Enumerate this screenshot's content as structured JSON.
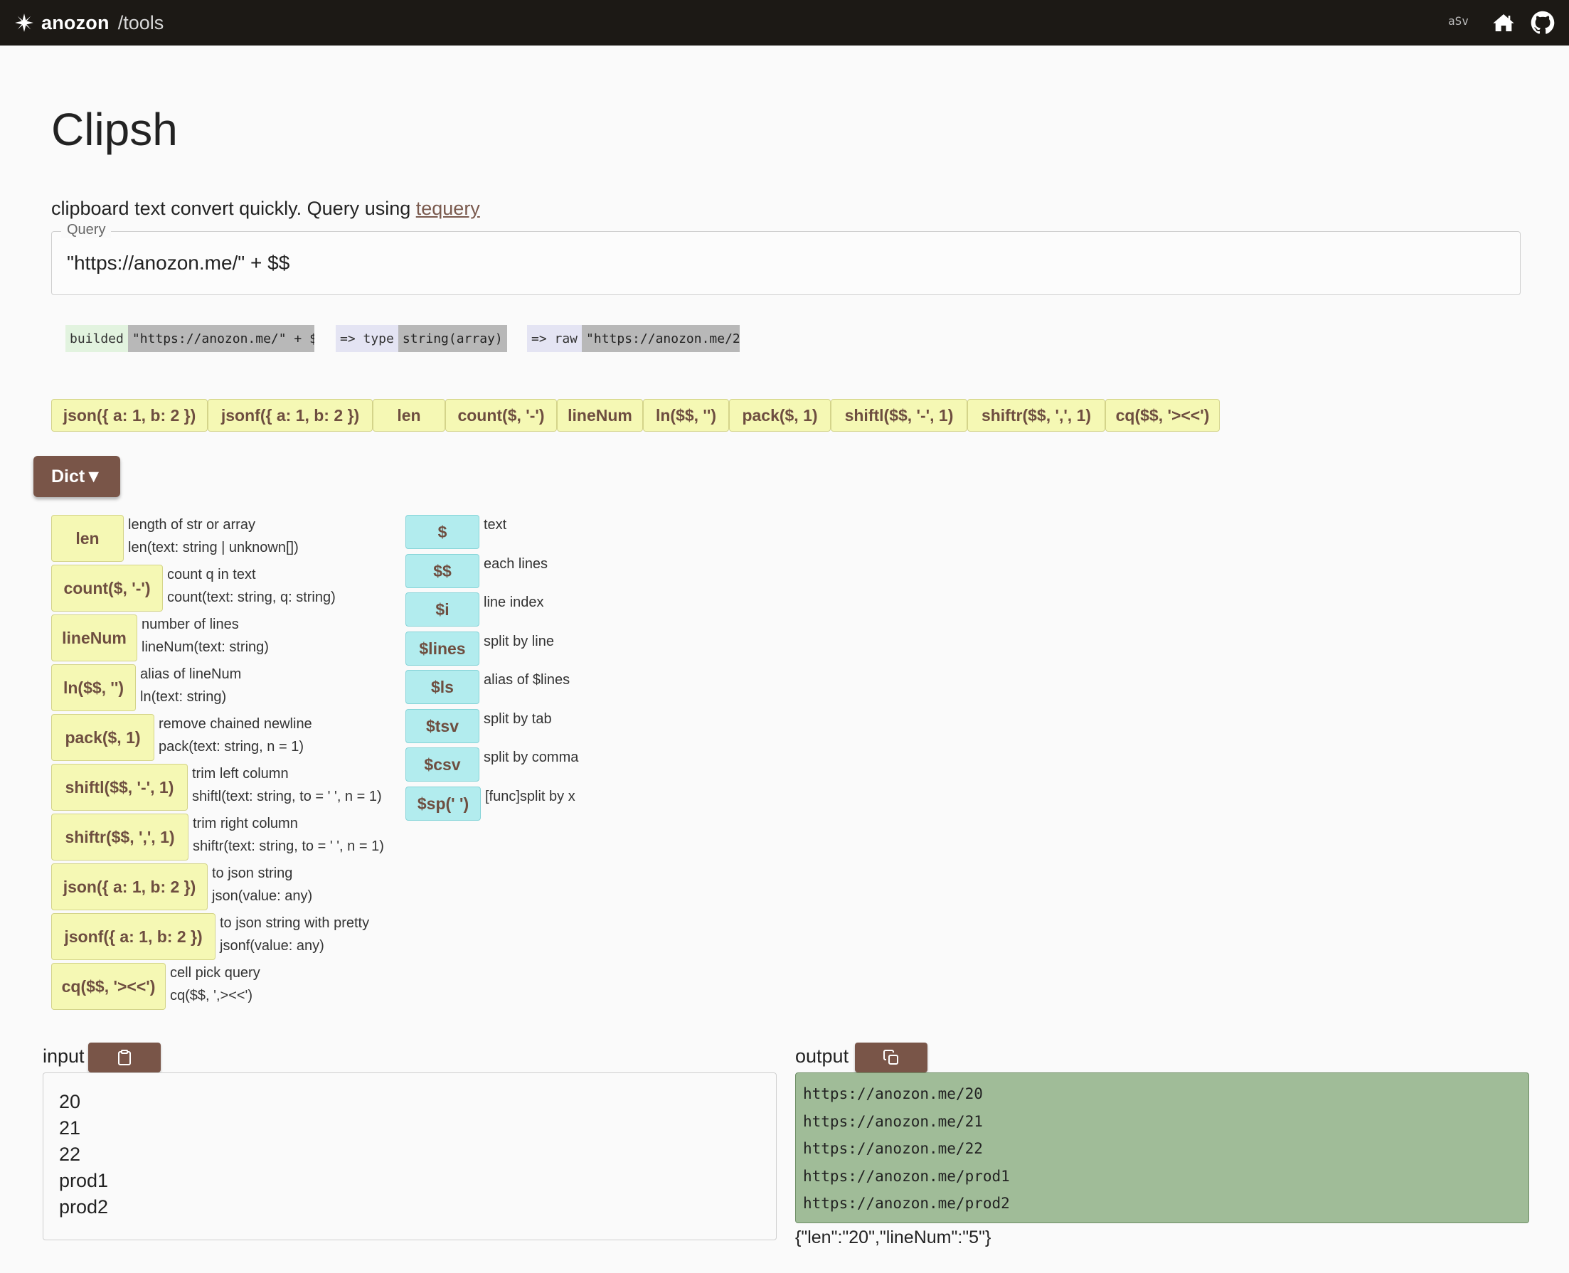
{
  "header": {
    "brand_name": "anozon",
    "brand_path": "/tools",
    "asv_label": "aSv",
    "home_icon": "home-icon",
    "github_icon": "github-icon"
  },
  "page": {
    "title": "Clipsh",
    "intro_text": "clipboard text convert quickly. Query using ",
    "intro_link": "tequery"
  },
  "query": {
    "legend": "Query",
    "value": "\"https://anozon.me/\" + $$"
  },
  "status": {
    "builded_label": "builded",
    "builded_value": "\"https://anozon.me/\" + $",
    "type_label": "=> type",
    "type_value": "string(array)",
    "raw_label": "=> raw",
    "raw_value": "\"https://anozon.me/2"
  },
  "quick_buttons": [
    "json({ a: 1, b: 2 })",
    "jsonf({ a: 1, b: 2 })",
    "len",
    "count($, '-')",
    "lineNum",
    "ln($$, '')",
    "pack($, 1)",
    "shiftl($$, '-', 1)",
    "shiftr($$, ',', 1)",
    "cq($$, '><<')"
  ],
  "dict": {
    "toggle_label": "Dict▼",
    "functions": [
      {
        "tag": "len",
        "desc": "length of str or array",
        "sig": "len(text: string | unknown[])"
      },
      {
        "tag": "count($, '-')",
        "desc": "count q in text",
        "sig": "count(text: string, q: string)"
      },
      {
        "tag": "lineNum",
        "desc": "number of lines",
        "sig": "lineNum(text: string)"
      },
      {
        "tag": "ln($$, '')",
        "desc": "alias of lineNum",
        "sig": "ln(text: string)"
      },
      {
        "tag": "pack($, 1)",
        "desc": "remove chained newline",
        "sig": "pack(text: string, n = 1)"
      },
      {
        "tag": "shiftl($$, '-', 1)",
        "desc": "trim left column",
        "sig": "shiftl(text: string, to = ' ', n = 1)"
      },
      {
        "tag": "shiftr($$, ',', 1)",
        "desc": "trim right column",
        "sig": "shiftr(text: string, to = ' ', n = 1)"
      },
      {
        "tag": "json({ a: 1, b: 2 })",
        "desc": "to json string",
        "sig": "json(value: any)"
      },
      {
        "tag": "jsonf({ a: 1, b: 2 })",
        "desc": "to json string with pretty",
        "sig": "jsonf(value: any)"
      },
      {
        "tag": "cq($$, '><<')",
        "desc": "cell pick query",
        "sig": "cq($$, ',><<')"
      }
    ],
    "variables": [
      {
        "tag": "$",
        "desc": "text"
      },
      {
        "tag": "$$",
        "desc": "each lines"
      },
      {
        "tag": "$i",
        "desc": "line index"
      },
      {
        "tag": "$lines",
        "desc": "split by line"
      },
      {
        "tag": "$ls",
        "desc": "alias of $lines"
      },
      {
        "tag": "$tsv",
        "desc": "split by tab"
      },
      {
        "tag": "$csv",
        "desc": "split by comma"
      },
      {
        "tag": "$sp(' ')",
        "desc": "[func]split by x"
      }
    ]
  },
  "input": {
    "label": "input",
    "copy_icon": "paste-icon",
    "lines": [
      "20",
      "21",
      "22",
      "prod1",
      "prod2"
    ]
  },
  "output": {
    "label": "output",
    "copy_icon": "copy-icon",
    "lines": [
      "https://anozon.me/20",
      "https://anozon.me/21",
      "https://anozon.me/22",
      "https://anozon.me/prod1",
      "https://anozon.me/prod2"
    ],
    "meta": "{\"len\":\"20\",\"lineNum\":\"5\"}"
  },
  "colors": {
    "topbar": "#1c1915",
    "accent_brown": "#795548",
    "function_tag": "#f5f8b4",
    "variable_tag": "#b2ecee",
    "output_bg": "#a0bc98",
    "link": "#7a5a4e"
  }
}
